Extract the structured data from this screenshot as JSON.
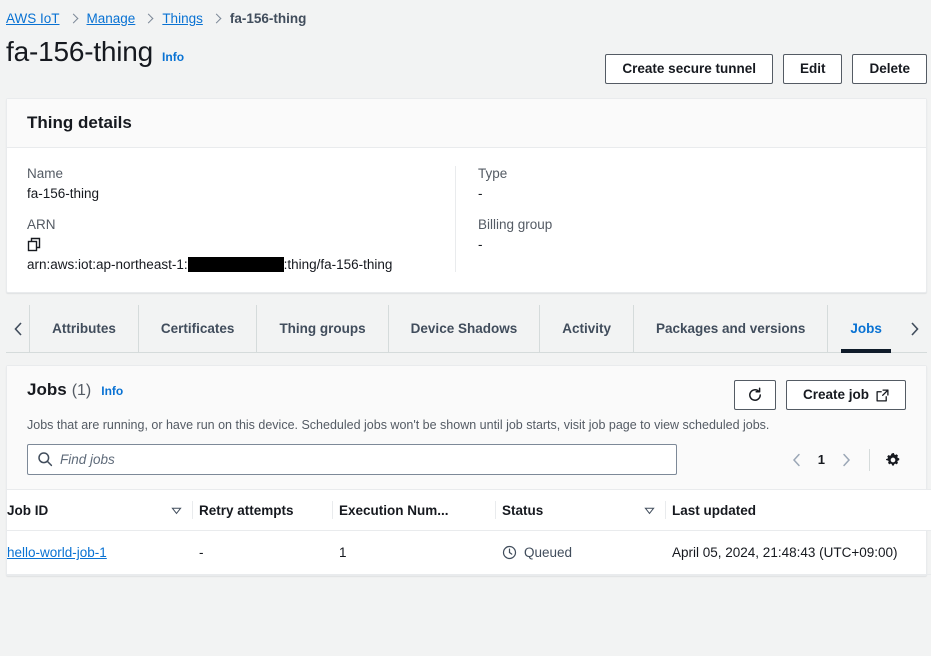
{
  "breadcrumb": {
    "items": [
      {
        "label": "AWS IoT",
        "current": false
      },
      {
        "label": "Manage",
        "current": false
      },
      {
        "label": "Things",
        "current": false
      },
      {
        "label": "fa-156-thing",
        "current": true
      }
    ]
  },
  "page": {
    "title": "fa-156-thing",
    "info_label": "Info"
  },
  "header_actions": {
    "create_secure_tunnel": "Create secure tunnel",
    "edit": "Edit",
    "delete": "Delete"
  },
  "thing_details": {
    "heading": "Thing details",
    "name_label": "Name",
    "name_value": "fa-156-thing",
    "arn_label": "ARN",
    "arn_copy_icon": "copy-icon",
    "arn_prefix": "arn:aws:iot:ap-northeast-1:",
    "arn_suffix": ":thing/fa-156-thing",
    "arn_redacted": true,
    "type_label": "Type",
    "type_value": "-",
    "billing_group_label": "Billing group",
    "billing_group_value": "-"
  },
  "tabs": {
    "prev_icon": "chevron-left-icon",
    "next_icon": "chevron-right-icon",
    "items": [
      {
        "label": "Attributes",
        "active": false
      },
      {
        "label": "Certificates",
        "active": false
      },
      {
        "label": "Thing groups",
        "active": false
      },
      {
        "label": "Device Shadows",
        "active": false
      },
      {
        "label": "Activity",
        "active": false
      },
      {
        "label": "Packages and versions",
        "active": false
      },
      {
        "label": "Jobs",
        "active": true
      }
    ]
  },
  "jobs_panel": {
    "title": "Jobs",
    "count": "(1)",
    "info_label": "Info",
    "description": "Jobs that are running, or have run on this device. Scheduled jobs won't be shown until job starts, visit job page to view scheduled jobs.",
    "refresh_icon": "refresh-icon",
    "create_job_label": "Create job",
    "create_job_icon": "external-link-icon",
    "search_placeholder": "Find jobs",
    "search_value": "",
    "search_icon": "search-icon",
    "pagination": {
      "prev_icon": "chevron-left-icon",
      "page": "1",
      "next_icon": "chevron-right-icon"
    },
    "settings_icon": "gear-icon",
    "table": {
      "columns": [
        {
          "label": "Job ID",
          "sortable": true
        },
        {
          "label": "Retry attempts",
          "sortable": false
        },
        {
          "label": "Execution Num...",
          "sortable": false
        },
        {
          "label": "Status",
          "sortable": true
        },
        {
          "label": "Last updated",
          "sortable": false
        }
      ],
      "rows": [
        {
          "job_id": "hello-world-job-1",
          "retry_attempts": "-",
          "execution_number": "1",
          "status": "Queued",
          "status_icon": "pending-clock-icon",
          "last_updated": "April 05, 2024, 21:48:43 (UTC+09:00)"
        }
      ]
    }
  },
  "colors": {
    "link": "#0972d3",
    "page_background": "#f2f3f3",
    "card_background": "#ffffff",
    "header_background": "#fafafa",
    "border": "#e9ebed",
    "text": "#16191f",
    "secondary_text": "#545b64",
    "active_tab_underline": "#0f1b2a"
  }
}
